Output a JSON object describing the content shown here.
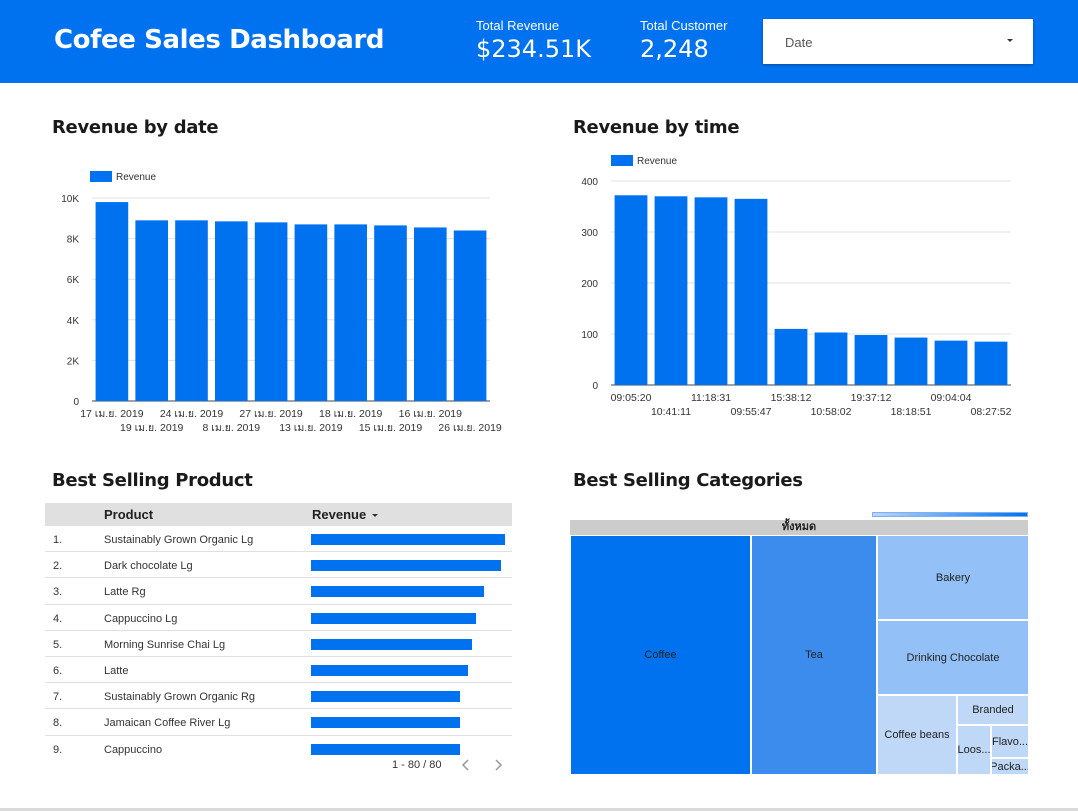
{
  "header": {
    "title": "Cofee Sales Dashboard",
    "kpi_revenue": {
      "label": "Total Revenue",
      "value": "$234.51K"
    },
    "kpi_customer": {
      "label": "Total Customer",
      "value": "2,248"
    },
    "date_filter": {
      "label": "Date"
    }
  },
  "colors": {
    "brand": "#0072f0",
    "header_text": "#ffffff",
    "tm_mid": "#3b8ced",
    "tm_light": "#92c0f7",
    "tm_lighter": "#bfd8f7"
  },
  "sections": {
    "revenue_by_date": "Revenue by date",
    "revenue_by_time": "Revenue by time",
    "best_selling_product": "Best Selling Product",
    "best_selling_categories": "Best Selling Categories"
  },
  "chart_data": [
    {
      "type": "bar",
      "title": "Revenue by date",
      "legend": [
        "Revenue"
      ],
      "categories": [
        "17 เม.ย. 2019",
        "19 เม.ย. 2019",
        "24 เม.ย. 2019",
        "8 เม.ย. 2019",
        "27 เม.ย. 2019",
        "13 เม.ย. 2019",
        "18 เม.ย. 2019",
        "15 เม.ย. 2019",
        "16 เม.ย. 2019",
        "26 เม.ย. 2019"
      ],
      "series": [
        {
          "name": "Revenue",
          "values": [
            9800,
            8900,
            8900,
            8850,
            8800,
            8700,
            8700,
            8650,
            8550,
            8400
          ]
        }
      ],
      "yticks": [
        "0",
        "2K",
        "4K",
        "6K",
        "8K",
        "10K"
      ],
      "ylim": [
        0,
        10000
      ],
      "grid": true,
      "legend_position": "top-left"
    },
    {
      "type": "bar",
      "title": "Revenue by time",
      "legend": [
        "Revenue"
      ],
      "categories": [
        "09:05:20",
        "10:41:11",
        "11:18:31",
        "09:55:47",
        "15:38:12",
        "10:58:02",
        "19:37:12",
        "18:18:51",
        "09:04:04",
        "08:27:52"
      ],
      "series": [
        {
          "name": "Revenue",
          "values": [
            372,
            370,
            368,
            365,
            110,
            103,
            98,
            93,
            87,
            85
          ]
        }
      ],
      "yticks": [
        "0",
        "100",
        "200",
        "300",
        "400"
      ],
      "ylim": [
        0,
        400
      ],
      "grid": true,
      "legend_position": "top-left"
    }
  ],
  "table": {
    "col_product": "Product",
    "col_revenue": "Revenue",
    "rows": [
      {
        "idx": "1.",
        "name": "Sustainably Grown Organic Lg",
        "share": 1.0
      },
      {
        "idx": "2.",
        "name": "Dark chocolate Lg",
        "share": 0.98
      },
      {
        "idx": "3.",
        "name": "Latte Rg",
        "share": 0.89
      },
      {
        "idx": "4.",
        "name": "Cappuccino Lg",
        "share": 0.85
      },
      {
        "idx": "5.",
        "name": "Morning Sunrise Chai Lg",
        "share": 0.83
      },
      {
        "idx": "6.",
        "name": "Latte",
        "share": 0.81
      },
      {
        "idx": "7.",
        "name": "Sustainably Grown Organic Rg",
        "share": 0.77
      },
      {
        "idx": "8.",
        "name": "Jamaican Coffee River Lg",
        "share": 0.77
      },
      {
        "idx": "9.",
        "name": "Cappuccino",
        "share": 0.77
      }
    ],
    "pager": "1 - 80 / 80"
  },
  "treemap": {
    "root_label": "ทั้งหมด",
    "cells": [
      {
        "name": "Coffee",
        "label": "Coffee"
      },
      {
        "name": "Tea",
        "label": "Tea"
      },
      {
        "name": "Bakery",
        "label": "Bakery"
      },
      {
        "name": "Drinking Chocolate",
        "label": "Drinking Chocolate"
      },
      {
        "name": "Coffee beans",
        "label": "Coffee beans"
      },
      {
        "name": "Branded",
        "label": "Branded"
      },
      {
        "name": "Loose Tea",
        "label": "Loos..."
      },
      {
        "name": "Flavours",
        "label": "Flavo..."
      },
      {
        "name": "Packaged Chocolate",
        "label": "Packa..."
      }
    ]
  }
}
